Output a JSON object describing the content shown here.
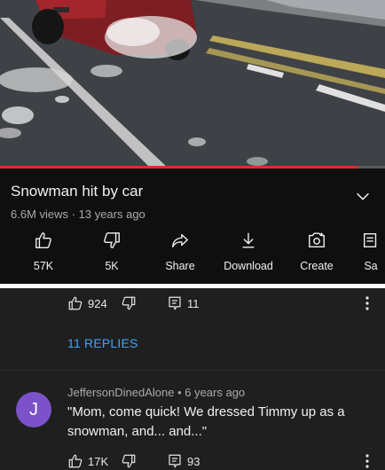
{
  "video": {
    "progress_fraction": 0.93
  },
  "meta": {
    "title": "Snowman hit by car",
    "views": "6.6M views",
    "age": "13 years ago",
    "sub_separator": "·"
  },
  "actions": [
    {
      "icon": "thumb-up-icon",
      "label": "57K"
    },
    {
      "icon": "thumb-down-icon",
      "label": "5K"
    },
    {
      "icon": "share-icon",
      "label": "Share"
    },
    {
      "icon": "download-icon",
      "label": "Download"
    },
    {
      "icon": "create-icon",
      "label": "Create"
    },
    {
      "icon": "save-icon",
      "label": "Sa"
    }
  ],
  "comments": {
    "first": {
      "likes": "924",
      "replies_count": "11",
      "view_replies": "11 REPLIES"
    },
    "second": {
      "avatar_letter": "J",
      "author_line": "JeffersonDinedAlone • 6 years ago",
      "text": "\"Mom, come quick! We dressed Timmy up as a snowman, and... and...\"",
      "likes": "17K",
      "replies_count": "93"
    }
  },
  "colors": {
    "accent_link": "#3ea6ff",
    "progress": "#e12b2b",
    "avatar": "#7b52c9"
  }
}
